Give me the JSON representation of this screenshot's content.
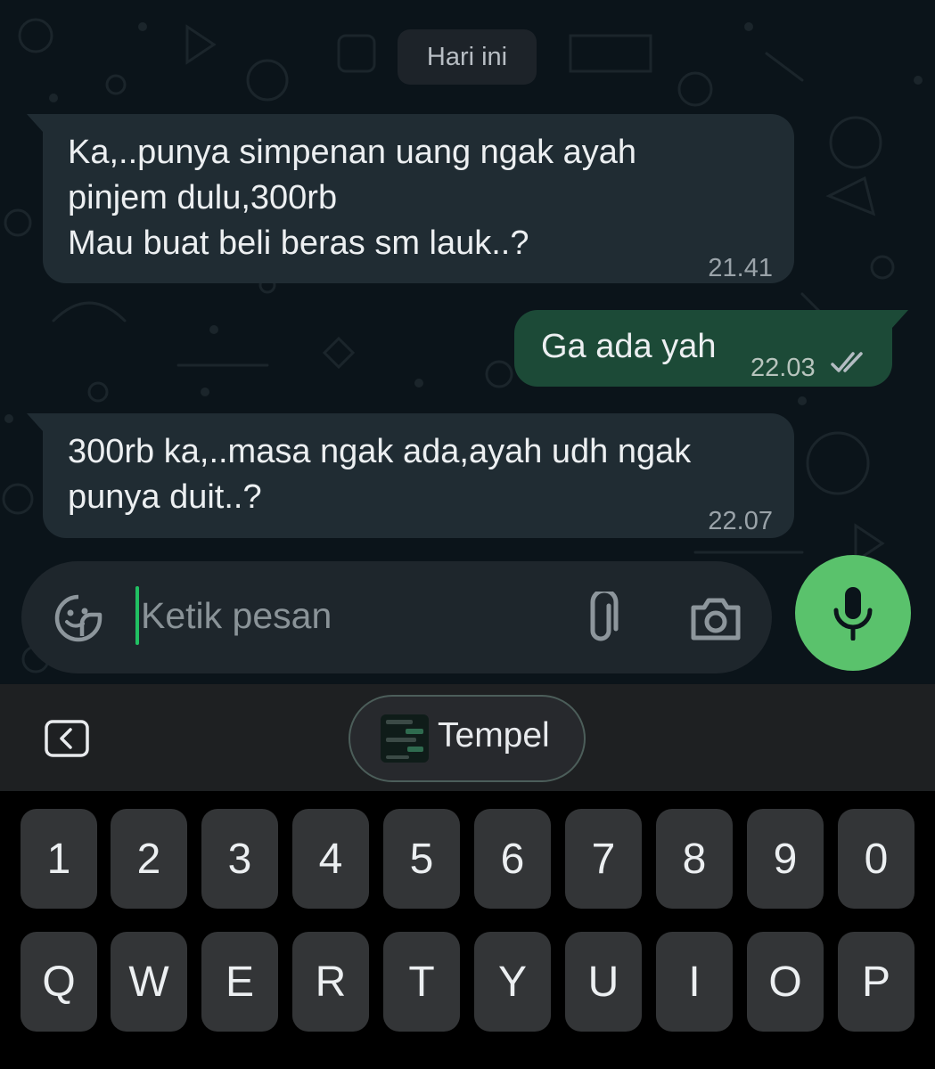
{
  "chat": {
    "date_label": "Hari ini",
    "messages": [
      {
        "direction": "incoming",
        "text": "Ka,..punya simpenan uang ngak ayah\npinjem dulu,300rb\nMau buat beli beras sm lauk..?",
        "time": "21.41"
      },
      {
        "direction": "outgoing",
        "text": "Ga ada yah",
        "time": "22.03",
        "status": "read"
      },
      {
        "direction": "incoming",
        "text": "300rb ka,..masa ngak ada,ayah udh ngak\npunya duit..?",
        "time": "22.07"
      }
    ]
  },
  "composer": {
    "placeholder": "Ketik pesan",
    "value": "",
    "icons": [
      "sticker-icon",
      "attach-icon",
      "camera-icon",
      "mic-icon"
    ]
  },
  "keyboard": {
    "toolbar": {
      "paste_label": "Tempel"
    },
    "number_row": [
      "1",
      "2",
      "3",
      "4",
      "5",
      "6",
      "7",
      "8",
      "9",
      "0"
    ],
    "letter_row": [
      "Q",
      "W",
      "E",
      "R",
      "T",
      "Y",
      "U",
      "I",
      "O",
      "P"
    ]
  },
  "colors": {
    "incoming_bubble": "#202c33",
    "outgoing_bubble": "#1c4a37",
    "mic_button": "#5ac26c",
    "caret": "#21c063"
  }
}
